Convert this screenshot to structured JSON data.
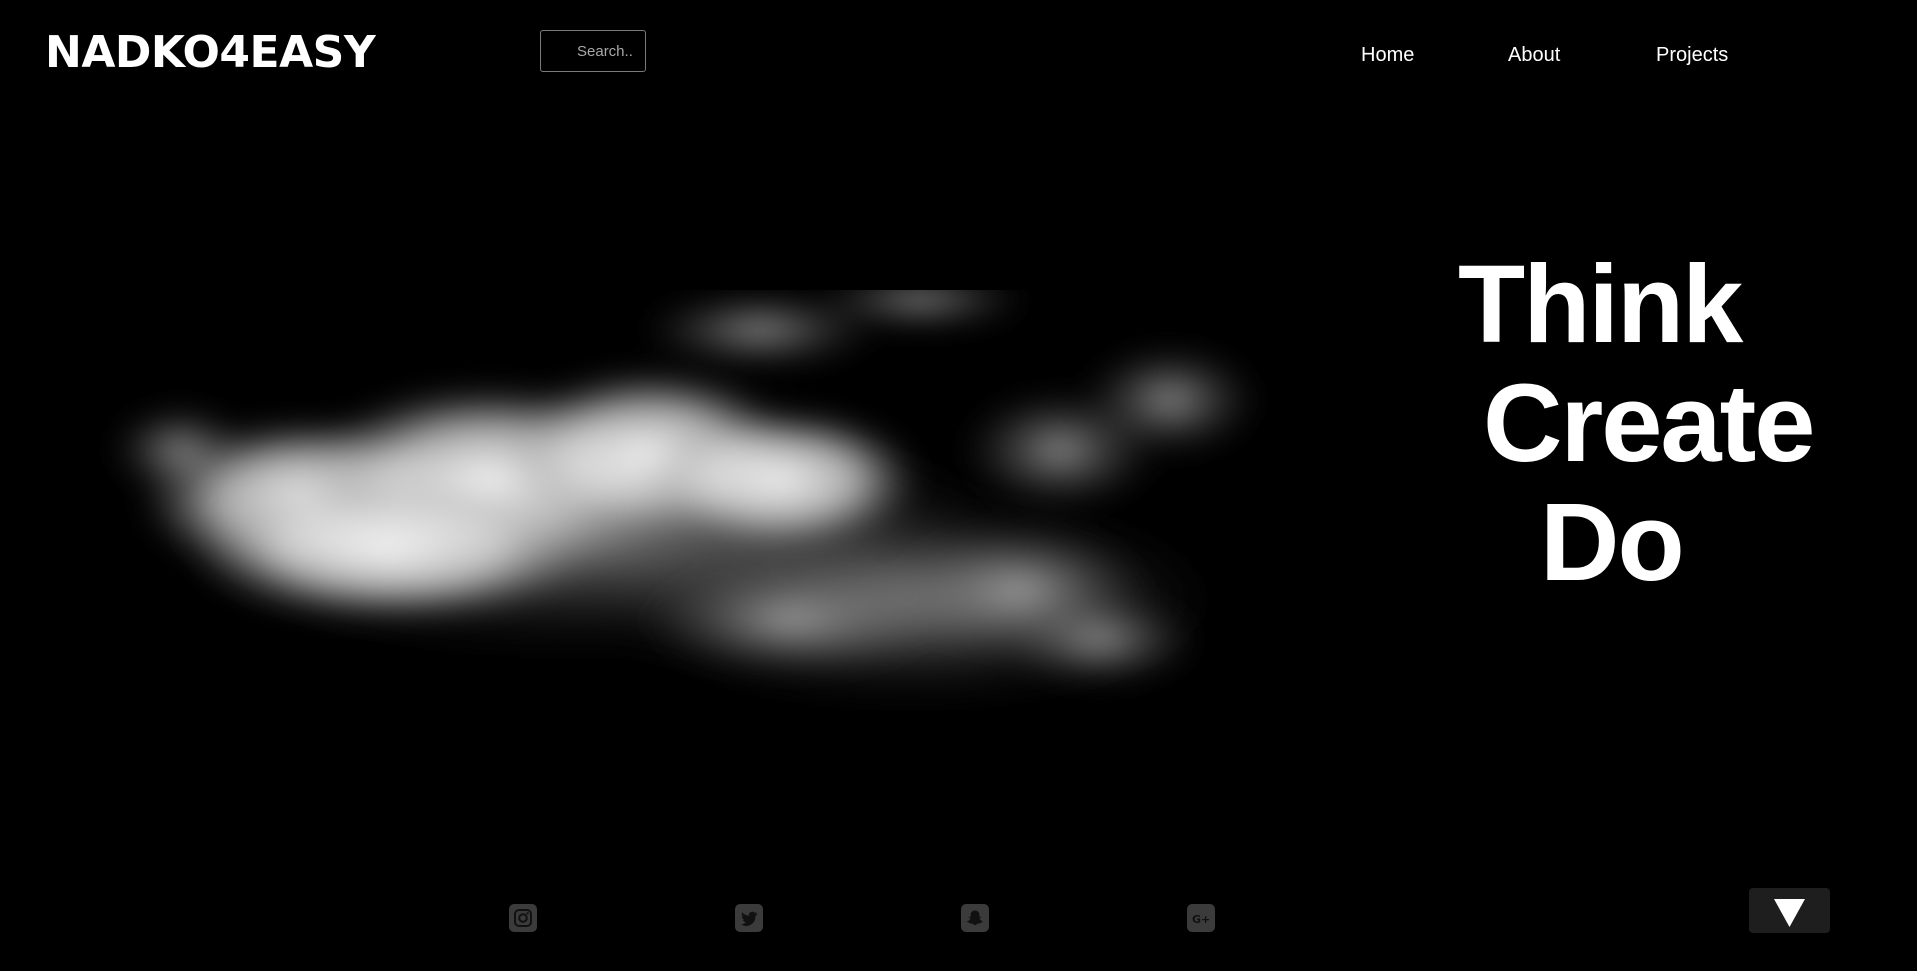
{
  "header": {
    "logo_text": "NADKO4EASY",
    "search": {
      "placeholder": "Search..",
      "value": ""
    },
    "nav": [
      {
        "label": "Home"
      },
      {
        "label": "About"
      },
      {
        "label": "Projects"
      }
    ]
  },
  "hero": {
    "image_icon": "cloud-image",
    "words": [
      "Think",
      "Create",
      "Do"
    ]
  },
  "footer": {
    "social_icons": [
      "instagram-icon",
      "twitter-icon",
      "snapchat-icon",
      "google-plus-icon"
    ],
    "scroll_button_icon": "triangle-down-icon"
  },
  "colors": {
    "background": "#000000",
    "text": "#ffffff",
    "icon_bg": "#3b3b3b",
    "scroll_button_bg": "#1e1e1e"
  }
}
